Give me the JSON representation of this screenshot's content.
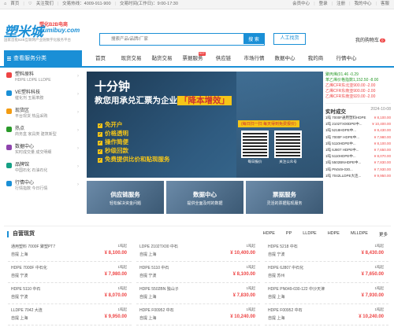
{
  "topbar": {
    "home": "首页",
    "follow": "关注我们",
    "hotline": "交易热线：4009-911-900",
    "hours": "交易时间(工作日)：9:00-17:30",
    "member_center": "会员中心",
    "login": "登录",
    "register": "注册",
    "my_center": "我的中心",
    "assistant": "客服"
  },
  "header": {
    "logo_main": "塑米城",
    "logo_tag": "塑化B2B电商",
    "logo_domain": "sumibuy.com",
    "slogan": "国家首批B2B互联网产业链数字化服务平台",
    "search_placeholder": "搜索产品/品牌/厂家",
    "search_button": "搜 索",
    "service_button": "人工找货",
    "cart_label": "我的购物车",
    "cart_count": "0"
  },
  "nav": {
    "all_categories": "查看服务分类",
    "items": [
      {
        "label": "首页",
        "hot": ""
      },
      {
        "label": "现货交易",
        "hot": ""
      },
      {
        "label": "黏货交易",
        "hot": ""
      },
      {
        "label": "票据服务",
        "hot": "HOT"
      },
      {
        "label": "供应链",
        "hot": ""
      },
      {
        "label": "市场行情",
        "hot": ""
      },
      {
        "label": "数据中心",
        "hot": ""
      },
      {
        "label": "我的商",
        "hot": ""
      },
      {
        "label": "行情中心",
        "hot": ""
      }
    ]
  },
  "sidebar": {
    "categories": [
      {
        "title": "塑料原料",
        "sub": "HDPE LDPE LLDPE",
        "color": "#e44"
      },
      {
        "title": "VE塑料科技",
        "sub": "催化剂 五氟苯胺",
        "color": "#1a8fd6"
      },
      {
        "title": "现货区",
        "sub": "平台现货 热品采购",
        "color": "#f39c12"
      },
      {
        "title": "热点",
        "sub": "商务盒 家具类 建筑新型",
        "color": "#2a9a2a"
      },
      {
        "title": "数据中心",
        "sub": "实时成交量 成交明细",
        "color": "#8e44ad"
      },
      {
        "title": "品牌馆",
        "sub": "中国石化 石油石化",
        "color": "#16a085"
      },
      {
        "title": "行情中心",
        "sub": "行情指数 今日行情",
        "color": "#1a8fd6"
      }
    ]
  },
  "banner": {
    "headline": "十分钟",
    "subline_pre": "教您用承兑汇票为企业",
    "subline_highlight": "「降本增效」",
    "features": [
      "免开户",
      "价格透明",
      "操作简便",
      "秒级回款",
      "免费提供比价和贴现服务"
    ],
    "note": "(每日扫一扫 每天得到免费报价)",
    "qr_labels": [
      "每日报价",
      "关注公众号"
    ]
  },
  "tiles": [
    {
      "title": "供应链服务",
      "sub": "轻松解决资金问题"
    },
    {
      "title": "数据中心",
      "sub": "提供全面及时的数据"
    },
    {
      "title": "票据服务",
      "sub": "灵活的票据贴现服务"
    }
  ],
  "quotes": [
    {
      "text": "聚丙烯(01.46 -0.29",
      "dir": "dn"
    },
    {
      "text": "苯乙烯价格指数1,152.50 -8.00",
      "dir": "dn"
    },
    {
      "text": "乙烯CFR东北亚900.00 -2.00",
      "dir": "up"
    },
    {
      "text": "乙烯CFR东南亚900.00 -2.00",
      "dir": "up"
    },
    {
      "text": "乙烯CFR东南亚920.00 -2.00",
      "dir": "up"
    }
  ],
  "realtime": {
    "title": "实时成交",
    "date": "2024-10-08",
    "rows": [
      {
        "name": "1吨 7000F通用塑料HDPE",
        "price": "¥ 8,100.00"
      },
      {
        "name": "1吨 2102TX00DPE中...",
        "price": "¥ 10,400.00"
      },
      {
        "name": "1吨 5218HDPE中...",
        "price": "¥ 8,430.00"
      },
      {
        "name": "1吨 7000F HDPE中...",
        "price": "¥ 7,980.00"
      },
      {
        "name": "1吨 5110HDPE中...",
        "price": "¥ 8,100.00"
      },
      {
        "name": "1吨 6J807 HDPE中...",
        "price": "¥ 7,650.00"
      },
      {
        "name": "1吨 5110HDPE中...",
        "price": "¥ 8,070.00"
      },
      {
        "name": "1吨 5502BNHDPE中...",
        "price": "¥ 7,830.00"
      },
      {
        "name": "1吨 PN049-030...",
        "price": "¥ 7,930.00"
      },
      {
        "name": "1吨 7042LLDPE大连...",
        "price": "¥ 9,950.00"
      }
    ]
  },
  "products": {
    "title": "自营现货",
    "tabs": [
      "HDPE",
      "PP",
      "LLDPE",
      "HDPE",
      "MLLDPE",
      "更多"
    ],
    "items": [
      {
        "name": "通用塑料 7000F 聚塑PT7",
        "tons": "1吨起",
        "loc": "自提 上海",
        "price": "¥ 8,100.00"
      },
      {
        "name": "LDPE 2102TX00 中石",
        "tons": "1吨起",
        "loc": "自提 上海",
        "price": "¥ 10,400.00"
      },
      {
        "name": "HDPE 5218 中石",
        "tons": "1吨起",
        "loc": "自提 宁波",
        "price": "¥ 8,430.00"
      },
      {
        "name": "HDPE 7000F 中石化",
        "tons": "1吨起",
        "loc": "自提 宁波",
        "price": "¥ 7,980.00"
      },
      {
        "name": "HDPE 5110 中石",
        "tons": "1吨起",
        "loc": "自提 宁波",
        "price": "¥ 8,100.00"
      },
      {
        "name": "HDPE 6J807 中石化",
        "tons": "1吨起",
        "loc": "自提 苏州",
        "price": "¥ 7,650.00"
      },
      {
        "name": "HDPE 5110 中石",
        "tons": "1吨起",
        "loc": "自提 宁波",
        "price": "¥ 8,070.00"
      },
      {
        "name": "HDPE 5502BN 独山子",
        "tons": "1吨起",
        "loc": "自提 上海",
        "price": "¥ 7,830.00"
      },
      {
        "name": "HDPE PN049-030-122 中沙天津",
        "tons": "1吨起",
        "loc": "自提 上海",
        "price": "¥ 7,930.00"
      },
      {
        "name": "LLDPE 7042 大连",
        "tons": "1吨起",
        "loc": "自提 上海",
        "price": "¥ 9,950.00"
      },
      {
        "name": "HDPE F00952 中石",
        "tons": "1吨起",
        "loc": "自提 上海",
        "price": "¥ 10,240.00"
      },
      {
        "name": "HDPE F00952 中石",
        "tons": "1吨起",
        "loc": "自提 上海",
        "price": "¥ 10,240.00"
      }
    ]
  },
  "colors": {
    "brand": "#1a8fd6",
    "price": "#e44",
    "accent": "#f5c518"
  }
}
